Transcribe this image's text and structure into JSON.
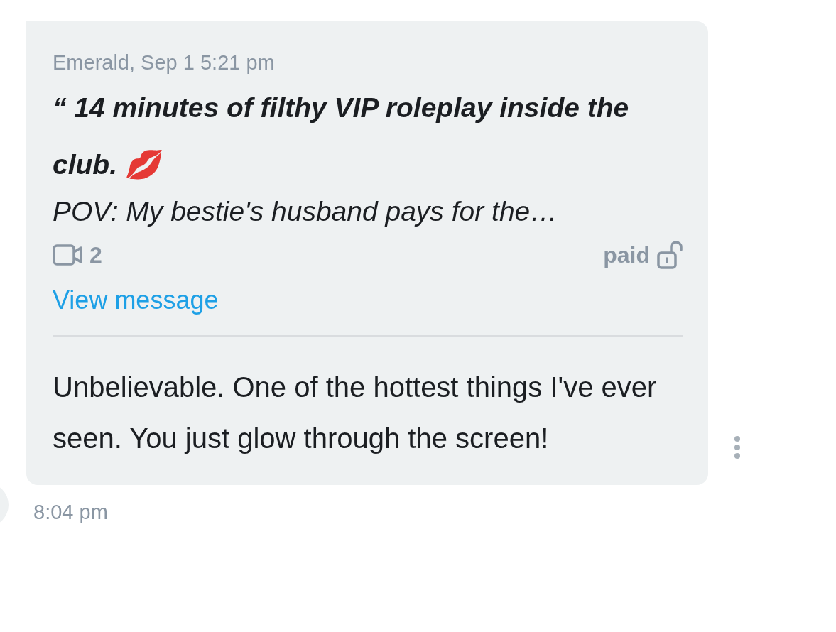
{
  "message": {
    "quote": {
      "header": "Emerald, Sep 1 5:21 pm",
      "title": "“ 14 minutes of filthy VIP roleplay inside the club. 💋",
      "subtitle": "POV: My bestie's husband pays for the…",
      "video_count": "2",
      "price_label": "paid",
      "locked": false,
      "link": "View message"
    },
    "text": "Unbelievable. One of the hottest things I've ever seen. You just glow through the screen!",
    "time": "8:04 pm"
  }
}
